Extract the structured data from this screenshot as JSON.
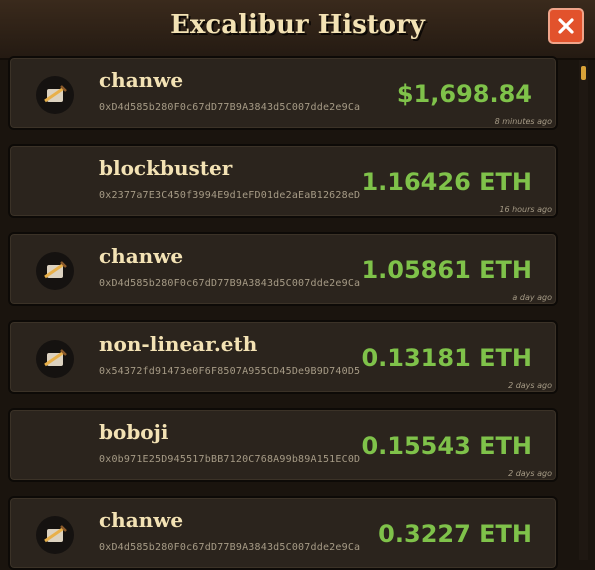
{
  "title": "Excalibur History",
  "close_icon": "close-x-icon",
  "colors": {
    "amount_green": "#7fc24a",
    "close_red": "#e2522c",
    "title_cream": "#f3e2b4"
  },
  "rows": [
    {
      "name": "chanwe",
      "address": "0xD4d585b280F0c67dD77B9A3843d5C007dde2e9Ca",
      "amount": "$1,698.84",
      "time": "8 minutes ago",
      "avatar": true
    },
    {
      "name": "blockbuster",
      "address": "0x2377a7E3C450f3994E9d1eFD01de2aEaB12628eD",
      "amount": "1.16426 ETH",
      "time": "16 hours ago",
      "avatar": false
    },
    {
      "name": "chanwe",
      "address": "0xD4d585b280F0c67dD77B9A3843d5C007dde2e9Ca",
      "amount": "1.05861 ETH",
      "time": "a day ago",
      "avatar": true
    },
    {
      "name": "non-linear.eth",
      "address": "0x54372fd91473e0F6F8507A955CD45De9B9D740D5",
      "amount": "0.13181 ETH",
      "time": "2 days ago",
      "avatar": true
    },
    {
      "name": "boboji",
      "address": "0x0b971E25D945517bBB7120C768A99b89A151EC0D",
      "amount": "0.15543 ETH",
      "time": "2 days ago",
      "avatar": false
    },
    {
      "name": "chanwe",
      "address": "0xD4d585b280F0c67dD77B9A3843d5C007dde2e9Ca",
      "amount": "0.3227 ETH",
      "time": "",
      "avatar": true
    }
  ]
}
